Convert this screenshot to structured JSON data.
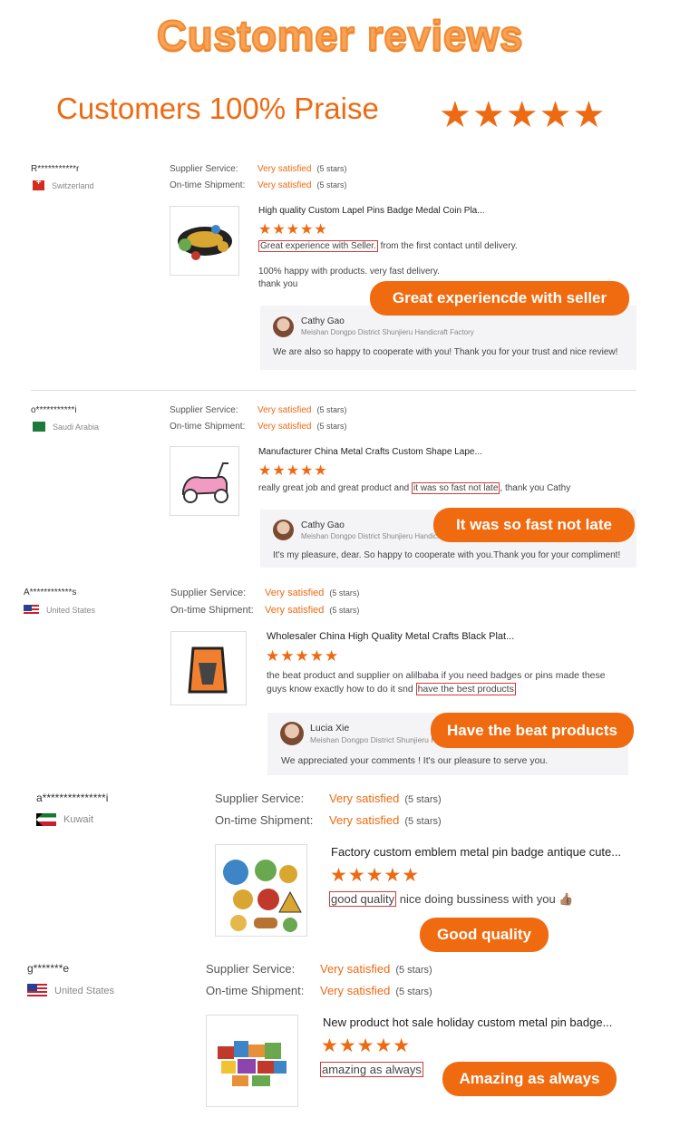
{
  "header": {
    "title": "Customer reviews",
    "praise": "Customers 100% Praise",
    "stars": "★★★★★"
  },
  "labels": {
    "supplier_service": "Supplier Service:",
    "ontime_shipment": "On-time Shipment:",
    "very_satisfied": "Very satisfied",
    "five_stars": "(5 stars)",
    "rating_stars": "★★★★★"
  },
  "reviews": [
    {
      "name": "R***********r",
      "country": "Switzerland",
      "product_title": "High quality Custom Lapel Pins Badge Medal Coin Pla...",
      "comment_highlight": "Great experience with Seller.",
      "comment_rest": " from the first contact until delivery.",
      "comment_2": "100% happy with products. very fast delivery.",
      "comment_3": "thank you",
      "reply_name": "Cathy Gao",
      "reply_company": "Meishan Dongpo District Shunjieru Handicraft Factory",
      "reply_message": "We are also so happy to cooperate with you! Thank you for your trust and nice review!",
      "tag": "Great experiencde with seller"
    },
    {
      "name": "o***********i",
      "country": "Saudi Arabia",
      "product_title": "Manufacturer China Metal Crafts Custom Shape Lape...",
      "comment_pre": "really great job and great product and ",
      "comment_highlight": "it was so fast not late",
      "comment_post": ", thank you Cathy",
      "reply_name": "Cathy Gao",
      "reply_company": "Meishan Dongpo District Shunjieru Handicraft Factory",
      "reply_message": "It's my pleasure, dear. So happy to cooperate with you.Thank you for your compliment!",
      "tag": "It was so fast not late"
    },
    {
      "name": "A************s",
      "country": "United States",
      "product_title": "Wholesaler China High Quality Metal Crafts Black Plat...",
      "comment_line1": "the beat product and supplier on alilbaba if you need badges or pins made these",
      "comment_line2_pre": "guys know exactly how to do it snd ",
      "comment_highlight": "have the best products",
      "reply_name": "Lucia Xie",
      "reply_company": "Meishan Dongpo District Shunjieru Handicraft Factory",
      "reply_message": "We appreciated your comments ! It's our pleasure to serve you.",
      "tag": "Have the beat products"
    },
    {
      "name": "a***************i",
      "country": "Kuwait",
      "product_title": "Factory custom emblem metal pin badge antique cute...",
      "comment_highlight": "good quality",
      "comment_rest": " nice doing bussiness with you 👍🏽",
      "tag": "Good quality"
    },
    {
      "name": "g*******e",
      "country": "United States",
      "product_title": "New product hot sale holiday custom metal pin badge...",
      "comment_highlight": "amazing as always",
      "tag": "Amazing as always"
    }
  ]
}
